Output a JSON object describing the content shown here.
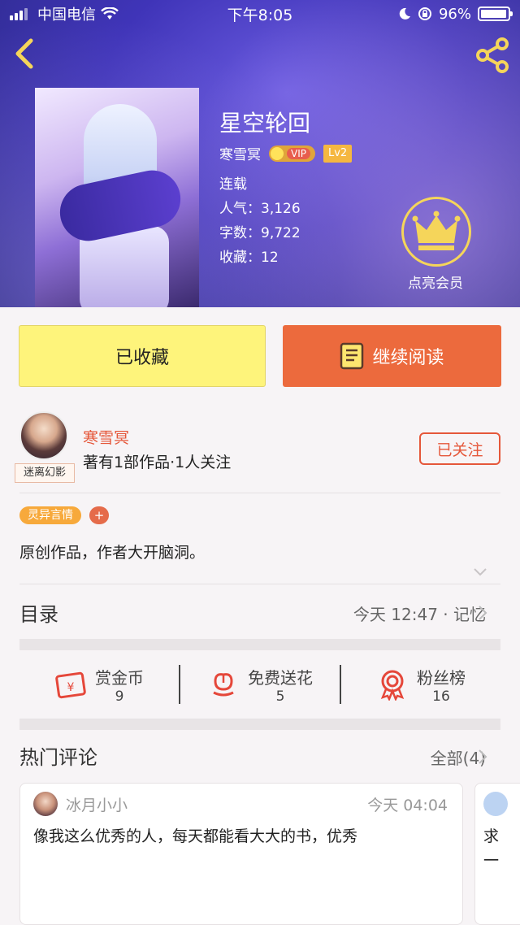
{
  "status_bar": {
    "carrier": "中国电信",
    "time": "下午8:05",
    "battery": "96%",
    "battery_level": 0.96
  },
  "book": {
    "title": "星空轮回",
    "author": "寒雪冥",
    "vip_label": "VIP",
    "level": "Lv2",
    "status": "连载",
    "popularity_label": "人气：",
    "popularity": "3,126",
    "words_label": "字数：",
    "words": "9,722",
    "favorites_label": "收藏：",
    "favorites": "12",
    "vip_member_label": "点亮会员"
  },
  "actions": {
    "favorited_label": "已收藏",
    "continue_reading_label": "继续阅读"
  },
  "author_section": {
    "name": "寒雪冥",
    "info": "著有1部作品·1人关注",
    "avatar_tag": "迷离幻影",
    "follow_label": "已关注"
  },
  "tags": {
    "genre": "灵异言情",
    "add": "+"
  },
  "description": "原创作品，作者大开脑洞。",
  "toc": {
    "title": "目录",
    "update": "今天 12:47 · 记忆"
  },
  "stats": [
    {
      "label": "赏金币",
      "value": "9",
      "icon": "coin-envelope-icon"
    },
    {
      "label": "免费送花",
      "value": "5",
      "icon": "flower-icon"
    },
    {
      "label": "粉丝榜",
      "value": "16",
      "icon": "medal-icon"
    }
  ],
  "comments_section": {
    "title": "热门评论",
    "all_label": "全部(4)"
  },
  "comments": [
    {
      "user": "冰月小小",
      "time": "今天 04:04",
      "text": "像我这么优秀的人，每天都能看大大的书，优秀"
    },
    {
      "text_line1": "求",
      "text_line2": "一"
    }
  ],
  "colors": {
    "accent_orange": "#ec6a3d",
    "fav_yellow": "#fef47b",
    "author_red": "#e5573a",
    "tag_orange": "#f7a93b"
  }
}
